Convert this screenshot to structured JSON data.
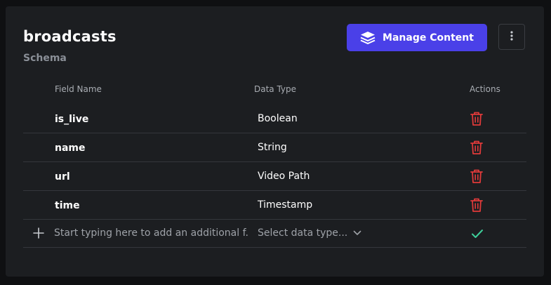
{
  "schema": {
    "title": "broadcasts",
    "subtitle": "Schema"
  },
  "toolbar": {
    "manage_label": "Manage Content"
  },
  "table": {
    "headers": {
      "field_name": "Field Name",
      "data_type": "Data Type",
      "actions": "Actions"
    },
    "rows": [
      {
        "name": "is_live",
        "type": "Boolean"
      },
      {
        "name": "name",
        "type": "String"
      },
      {
        "name": "url",
        "type": "Video Path"
      },
      {
        "name": "time",
        "type": "Timestamp"
      }
    ]
  },
  "add_field": {
    "placeholder": "Start typing here to add an additional f...",
    "select_label": "Select data type..."
  },
  "colors": {
    "accent": "#4a40e8",
    "delete": "#e03a3a",
    "confirm": "#3ecf9a",
    "card_bg": "#1c1e21"
  },
  "icons": [
    "layers-icon",
    "vertical-dots-icon",
    "trash-icon",
    "plus-icon",
    "chevron-down-icon",
    "check-icon"
  ]
}
